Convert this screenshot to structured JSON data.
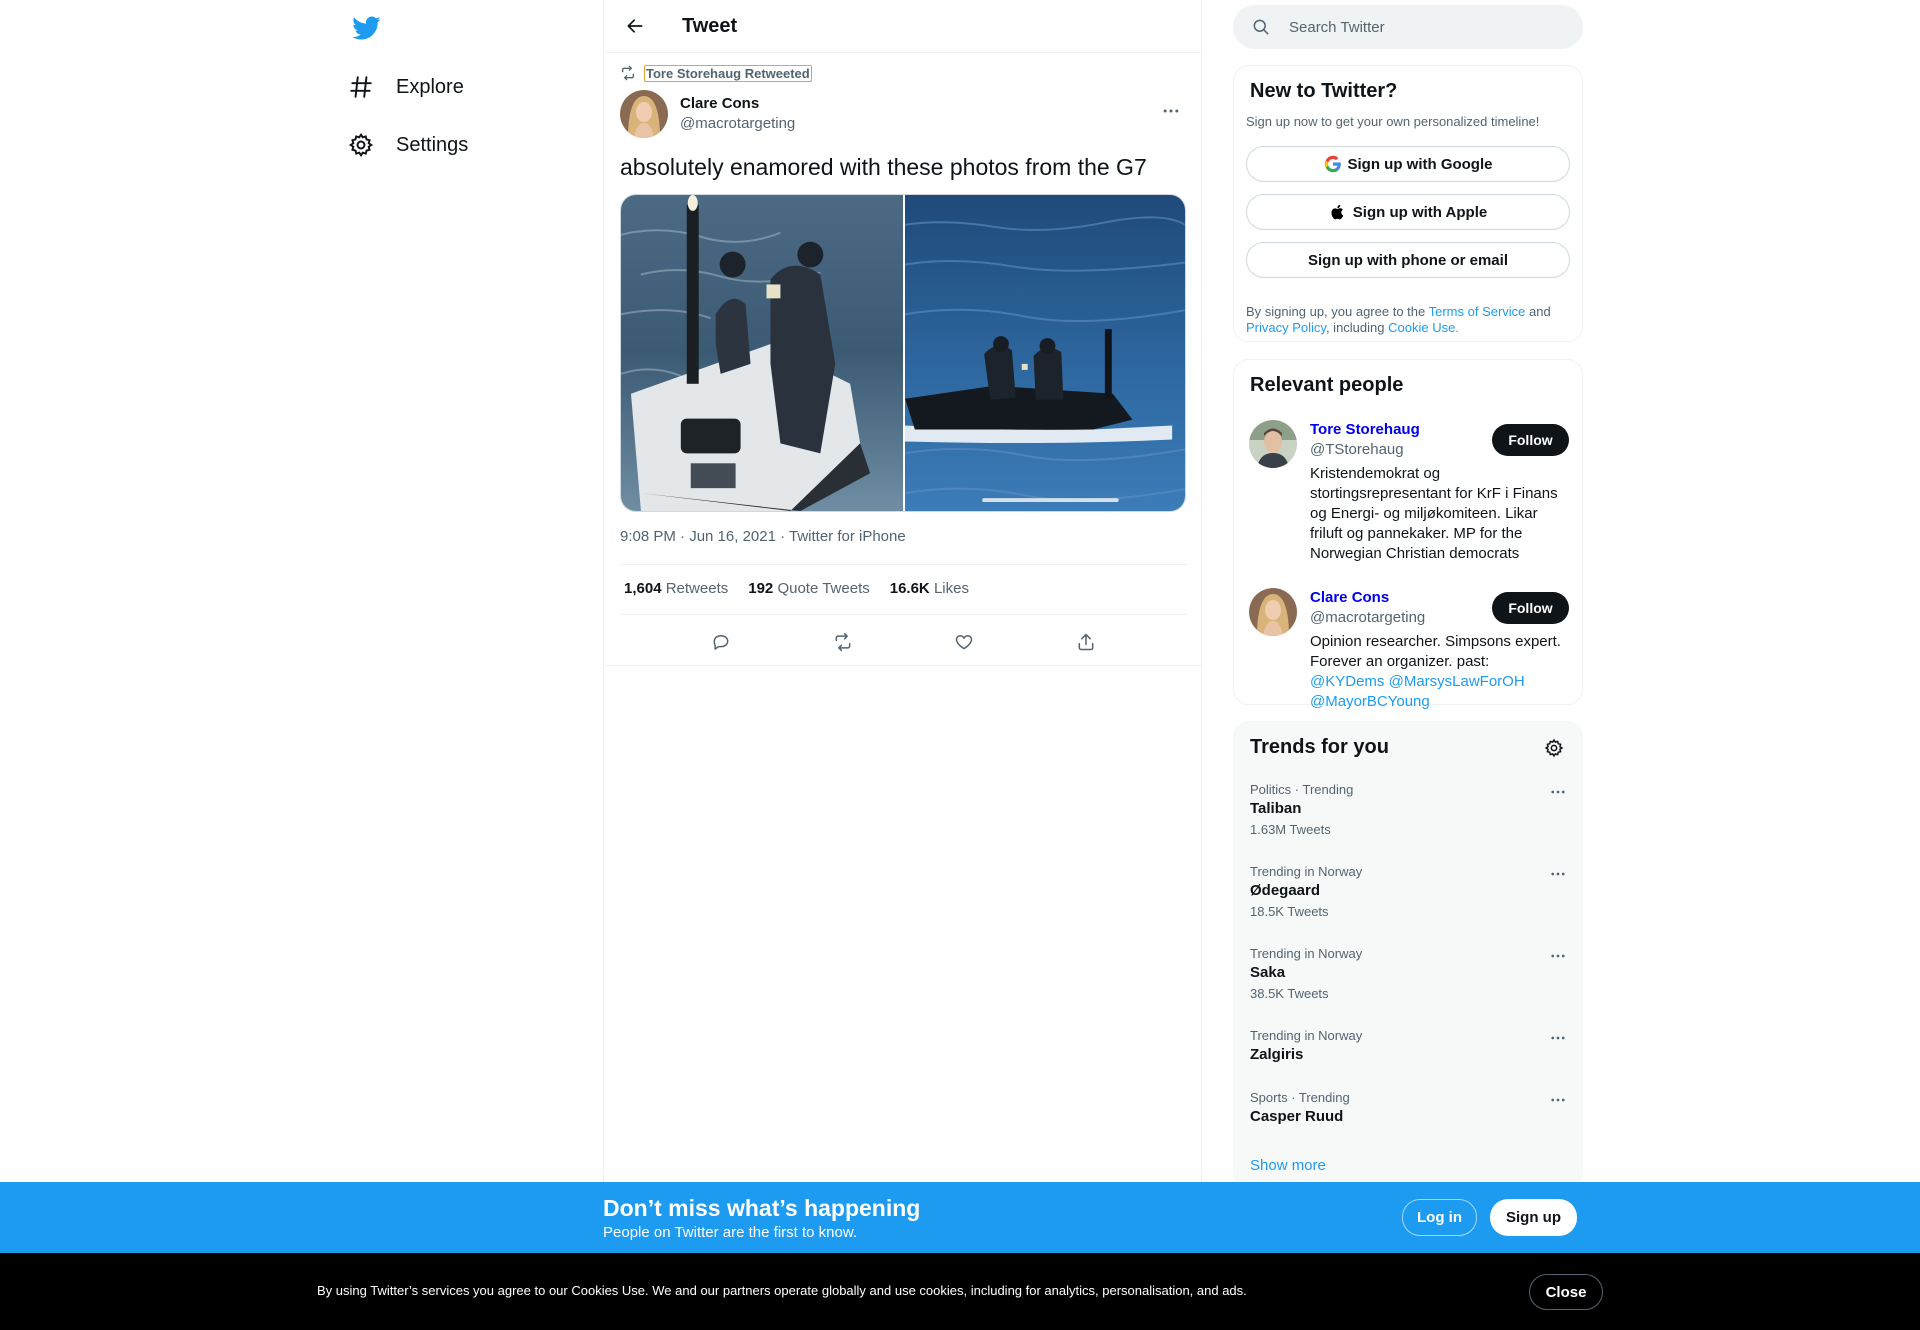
{
  "nav": {
    "logo_icon": "twitter-bird-icon",
    "items": [
      {
        "label": "Explore",
        "icon": "hashtag-icon"
      },
      {
        "label": "Settings",
        "icon": "gear-icon"
      }
    ]
  },
  "header": {
    "title": "Tweet"
  },
  "tweet": {
    "retweeted_by": "Tore Storehaug Retweeted",
    "author_name": "Clare Cons",
    "author_handle": "@macrotargeting",
    "text": "absolutely enamored with these photos from the G7",
    "meta": "9:08 PM · Jun 16, 2021 · Twitter for iPhone",
    "stats": [
      {
        "num": "1,604",
        "label": "Retweets"
      },
      {
        "num": "192",
        "label": "Quote Tweets"
      },
      {
        "num": "16.6K",
        "label": "Likes"
      }
    ]
  },
  "search": {
    "placeholder": "Search Twitter"
  },
  "signup_card": {
    "title": "New to Twitter?",
    "subtitle": "Sign up now to get your own personalized timeline!",
    "google_label": "Sign up with Google",
    "apple_label": "Sign up with Apple",
    "phone_label": "Sign up with phone or email",
    "legal_prefix": "By signing up, you agree to the ",
    "terms_link": "Terms of Service",
    "legal_and": " and",
    "privacy_link": "Privacy Policy",
    "legal_including": ", including ",
    "cookie_link": "Cookie Use."
  },
  "relevant": {
    "title": "Relevant people",
    "people": [
      {
        "name": "Tore Storehaug",
        "handle": "@TStorehaug",
        "bio": "Kristendemokrat og stortingsrepresentant for KrF i Finans og Energi- og miljøkomiteen. Likar friluft og pannekaker. MP for the Norwegian Christian democrats",
        "follow_label": "Follow"
      },
      {
        "name": "Clare Cons",
        "handle": "@macrotargeting",
        "bio_text": "Opinion researcher. Simpsons expert. Forever an organizer. past: ",
        "bio_mentions": [
          "@KYDems",
          "@MarsysLawForOH",
          "@MayorBCYoung"
        ],
        "follow_label": "Follow"
      }
    ]
  },
  "trends": {
    "title": "Trends for you",
    "items": [
      {
        "context": "Politics · Trending",
        "name": "Taliban",
        "count": "1.63M Tweets"
      },
      {
        "context": "Trending in Norway",
        "name": "Ødegaard",
        "count": "18.5K Tweets"
      },
      {
        "context": "Trending in Norway",
        "name": "Saka",
        "count": "38.5K Tweets"
      },
      {
        "context": "Trending in Norway",
        "name": "Zalgiris",
        "count": ""
      },
      {
        "context": "Sports · Trending",
        "name": "Casper Ruud",
        "count": ""
      }
    ],
    "show_more": "Show more"
  },
  "bottom_bar": {
    "title": "Don’t miss what’s happening",
    "subtitle": "People on Twitter are the first to know.",
    "login_label": "Log in",
    "signup_label": "Sign up"
  },
  "cookie": {
    "text": "By using Twitter’s services you agree to our Cookies Use. We and our partners operate globally and use cookies, including for analytics, personalisation, and ads.",
    "close_label": "Close"
  },
  "colors": {
    "accent": "#1d9bf0",
    "text": "#0f1419",
    "secondary": "#536471"
  }
}
